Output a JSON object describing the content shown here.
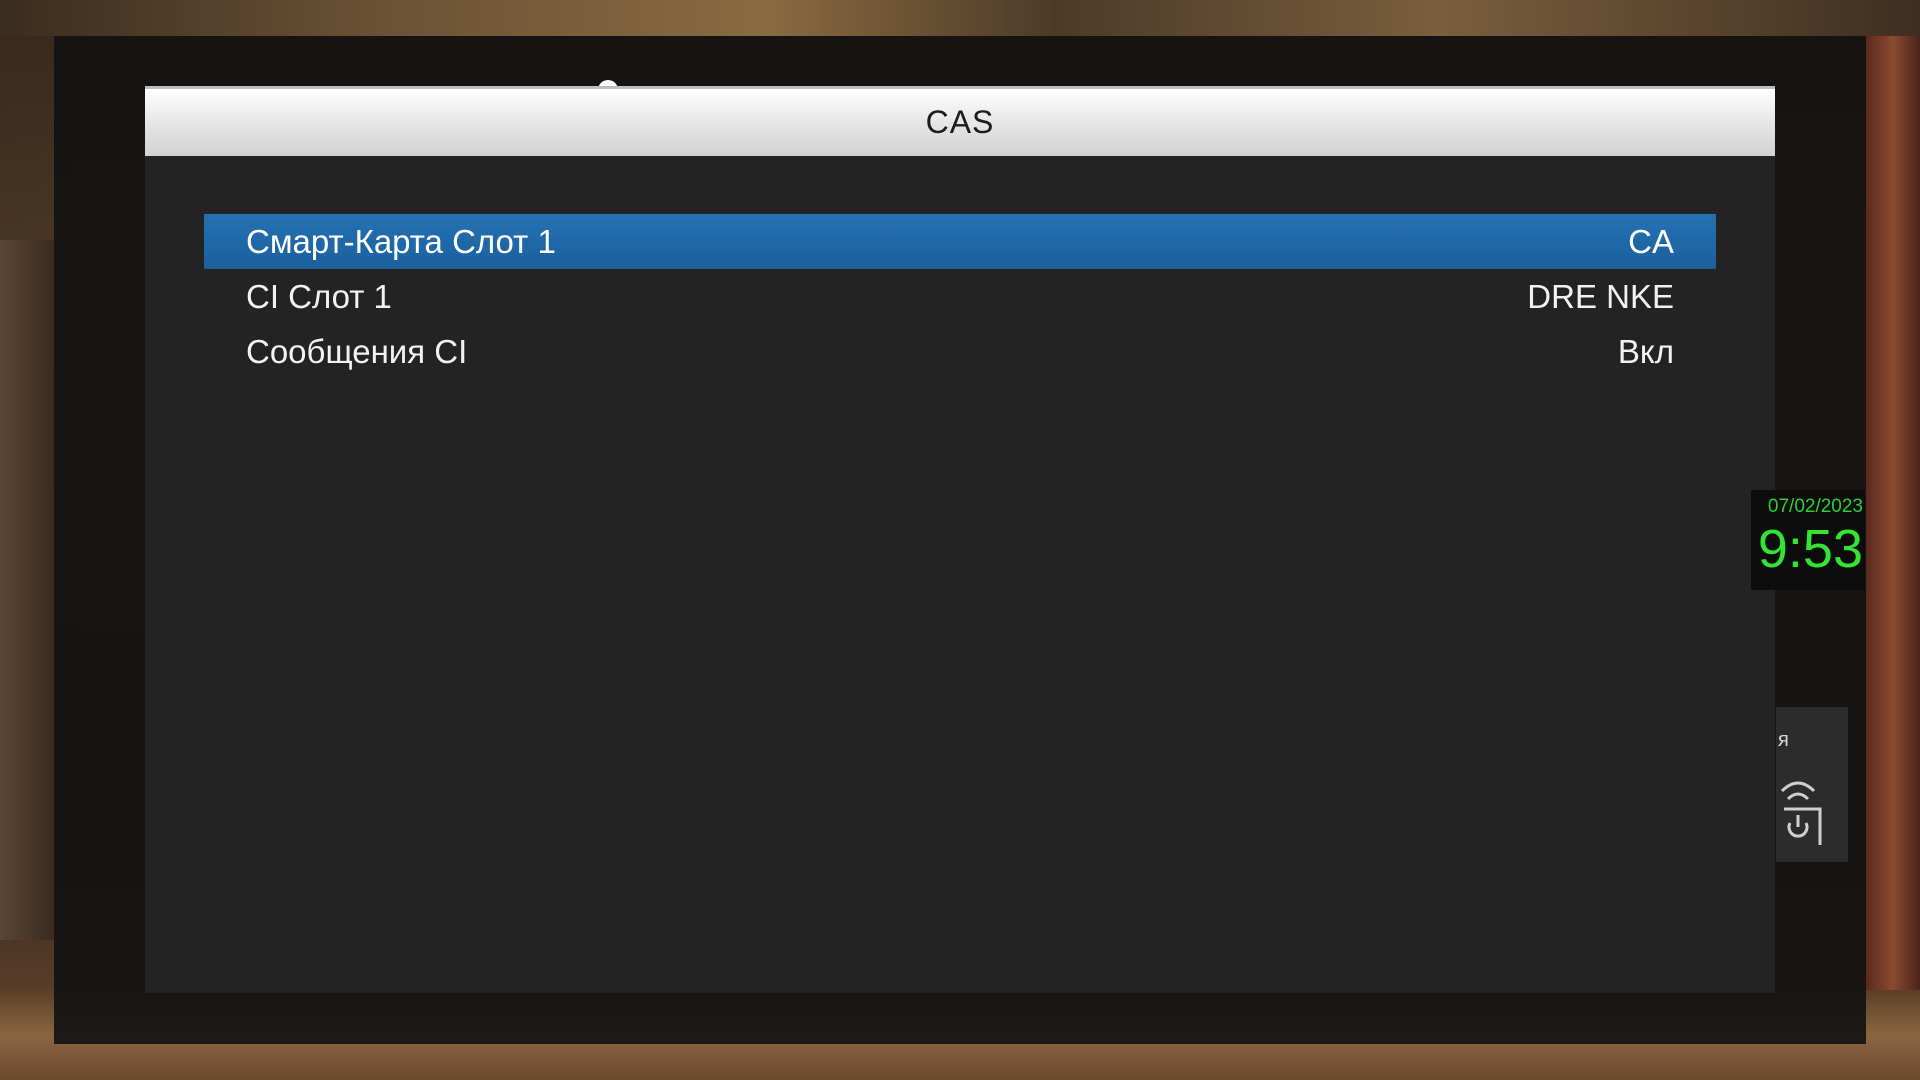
{
  "dialog": {
    "title": "CAS"
  },
  "menu": {
    "items": [
      {
        "label": "Смарт-Карта Слот 1",
        "value": "CA",
        "selected": true
      },
      {
        "label": "CI Слот 1",
        "value": "DRE NKE",
        "selected": false
      },
      {
        "label": "Сообщения CI",
        "value": "Вкл",
        "selected": false
      }
    ]
  },
  "clock": {
    "date": "07/02/2023",
    "time": "9:53"
  },
  "side_widget": {
    "letter": "я",
    "icon": "remote-power-icon"
  },
  "colors": {
    "selection": "#1f67a8",
    "panel_bg": "#232323",
    "title_bar": "#e4e4e4",
    "clock_text": "#33e433"
  }
}
